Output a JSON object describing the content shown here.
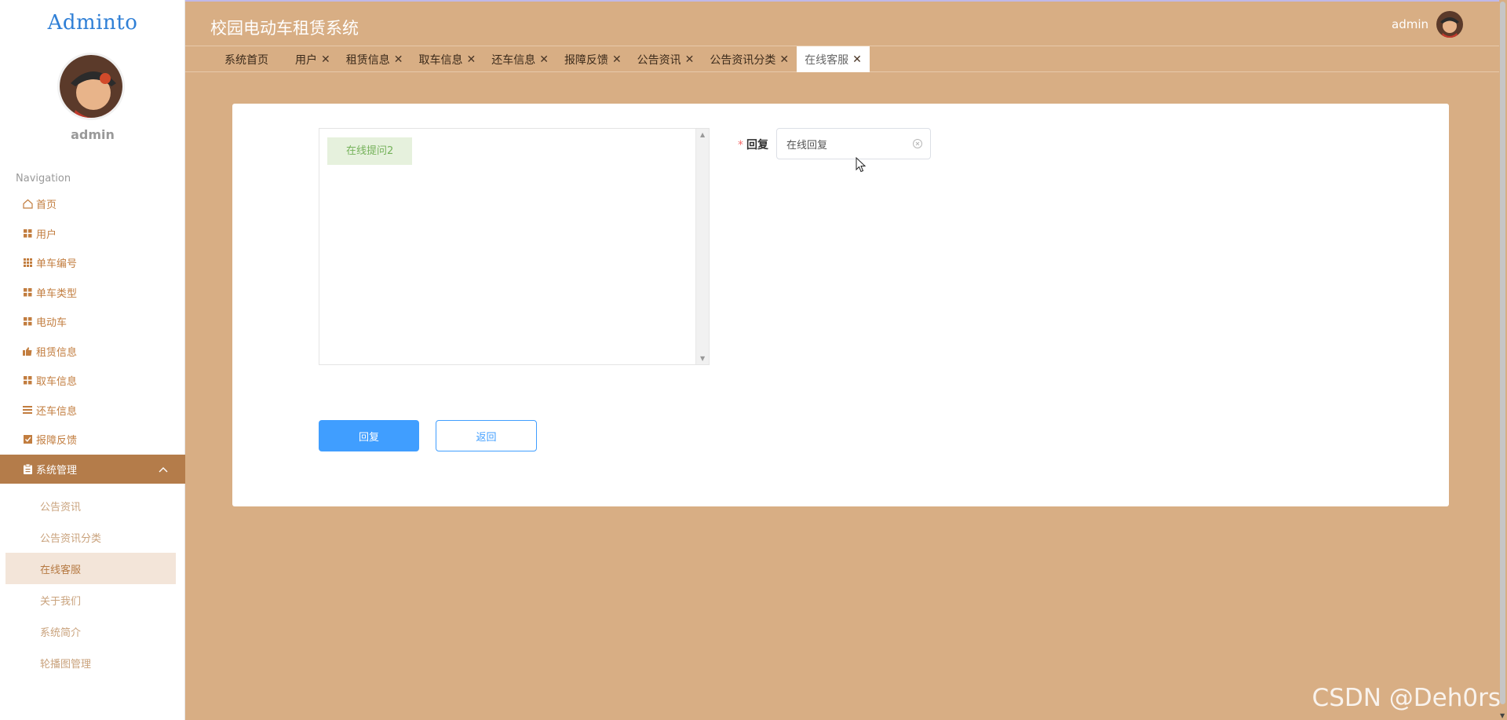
{
  "app": {
    "logo": "Adminto",
    "title": "校园电动车租赁系统",
    "username": "admin"
  },
  "sidebar": {
    "username": "admin",
    "nav_title": "Navigation",
    "items": [
      {
        "label": "首页",
        "icon": "home-icon"
      },
      {
        "label": "用户",
        "icon": "grid-icon"
      },
      {
        "label": "单车编号",
        "icon": "grid9-icon"
      },
      {
        "label": "单车类型",
        "icon": "grid-icon"
      },
      {
        "label": "电动车",
        "icon": "grid-icon"
      },
      {
        "label": "租赁信息",
        "icon": "thumbs-up-icon"
      },
      {
        "label": "取车信息",
        "icon": "grid-icon"
      },
      {
        "label": "还车信息",
        "icon": "list-icon"
      },
      {
        "label": "报障反馈",
        "icon": "check-square-icon"
      },
      {
        "label": "系统管理",
        "icon": "clipboard-icon"
      }
    ],
    "sub_items": [
      {
        "label": "公告资讯"
      },
      {
        "label": "公告资讯分类"
      },
      {
        "label": "在线客服"
      },
      {
        "label": "关于我们"
      },
      {
        "label": "系统简介"
      },
      {
        "label": "轮播图管理"
      }
    ]
  },
  "tabs": [
    {
      "label": "系统首页",
      "closable": false
    },
    {
      "label": "用户",
      "closable": true
    },
    {
      "label": "租赁信息",
      "closable": true
    },
    {
      "label": "取车信息",
      "closable": true
    },
    {
      "label": "还车信息",
      "closable": true
    },
    {
      "label": "报障反馈",
      "closable": true
    },
    {
      "label": "公告资讯",
      "closable": true
    },
    {
      "label": "公告资讯分类",
      "closable": true
    },
    {
      "label": "在线客服",
      "closable": true,
      "active": true
    }
  ],
  "tab_close_glyph": "✕",
  "chat": {
    "messages": [
      "在线提问2"
    ]
  },
  "form": {
    "required_mark": "*",
    "reply_label": "回复",
    "reply_value": "在线回复"
  },
  "buttons": {
    "reply": "回复",
    "back": "返回"
  },
  "watermark": "CSDN @Deh0rs",
  "colors": {
    "background": "#d8ae84",
    "active_menu": "#b47c4a",
    "primary": "#409eff",
    "chat_bubble": "#e6f1dd"
  }
}
